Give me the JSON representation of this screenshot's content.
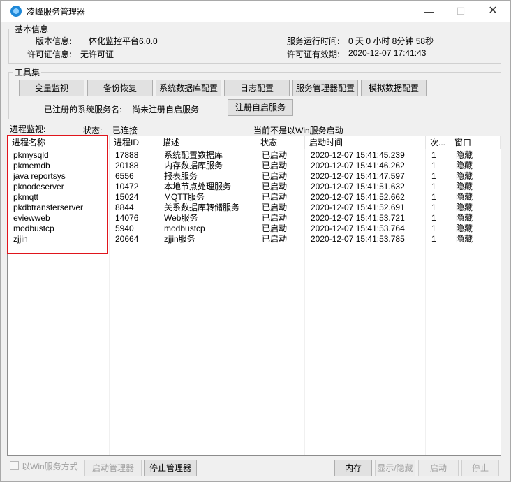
{
  "window": {
    "title": "凌峰服务管理器",
    "controls": {
      "minimize": "—",
      "maximize": "☐",
      "close": "✕"
    }
  },
  "basic_info": {
    "legend": "基本信息",
    "version_label": "版本信息:",
    "version_value": "一体化监控平台6.0.0",
    "license_label": "许可证信息:",
    "license_value": "无许可证",
    "runtime_label": "服务运行时间:",
    "runtime_value": "0 天 0 小时 8分钟 58秒",
    "license_valid_label": "许可证有效期:",
    "license_valid_value": "2020-12-07 17:41:43"
  },
  "toolbox": {
    "legend": "工具集",
    "buttons": [
      "变量监视",
      "备份恢复",
      "系统数据库配置",
      "日志配置",
      "服务管理器配置",
      "模拟数据配置"
    ],
    "registered_label": "已注册的系统服务名:",
    "registered_value": "尚未注册自启服务",
    "register_button": "注册自启服务"
  },
  "process_monitor": {
    "label": "进程监视:",
    "status_label": "状态:",
    "status_value": "已连接",
    "win_service_note": "当前不是以Win服务启动",
    "columns": [
      "进程名称",
      "进程ID",
      "描述",
      "状态",
      "启动时间",
      "次...",
      "窗口"
    ],
    "rows": [
      [
        "pkmysqld",
        "17888",
        "系统配置数据库",
        "已启动",
        "2020-12-07 15:41:45.239",
        "1",
        "隐藏"
      ],
      [
        "pkmemdb",
        "20188",
        "内存数据库服务",
        "已启动",
        "2020-12-07 15:41:46.262",
        "1",
        "隐藏"
      ],
      [
        "java reportsys",
        "6556",
        "报表服务",
        "已启动",
        "2020-12-07 15:41:47.597",
        "1",
        "隐藏"
      ],
      [
        "pknodeserver",
        "10472",
        "本地节点处理服务",
        "已启动",
        "2020-12-07 15:41:51.632",
        "1",
        "隐藏"
      ],
      [
        "pkmqtt",
        "15024",
        "MQTT服务",
        "已启动",
        "2020-12-07 15:41:52.662",
        "1",
        "隐藏"
      ],
      [
        "pkdbtransferserver",
        "8844",
        "关系数据库转储服务",
        "已启动",
        "2020-12-07 15:41:52.691",
        "1",
        "隐藏"
      ],
      [
        "eviewweb",
        "14076",
        "Web服务",
        "已启动",
        "2020-12-07 15:41:53.721",
        "1",
        "隐藏"
      ],
      [
        "modbustcp",
        "5940",
        "modbustcp",
        "已启动",
        "2020-12-07 15:41:53.764",
        "1",
        "隐藏"
      ],
      [
        "zjjin",
        "20664",
        "zjjin服务",
        "已启动",
        "2020-12-07 15:41:53.785",
        "1",
        "隐藏"
      ]
    ]
  },
  "bottom": {
    "checkbox_label": "以Win服务方式",
    "start_manager": "启动管理器",
    "stop_manager": "停止管理器",
    "memory": "内存",
    "show_hide": "显示/隐藏",
    "start": "启动",
    "stop": "停止"
  },
  "colors": {
    "highlight_box": "#e0151c"
  }
}
